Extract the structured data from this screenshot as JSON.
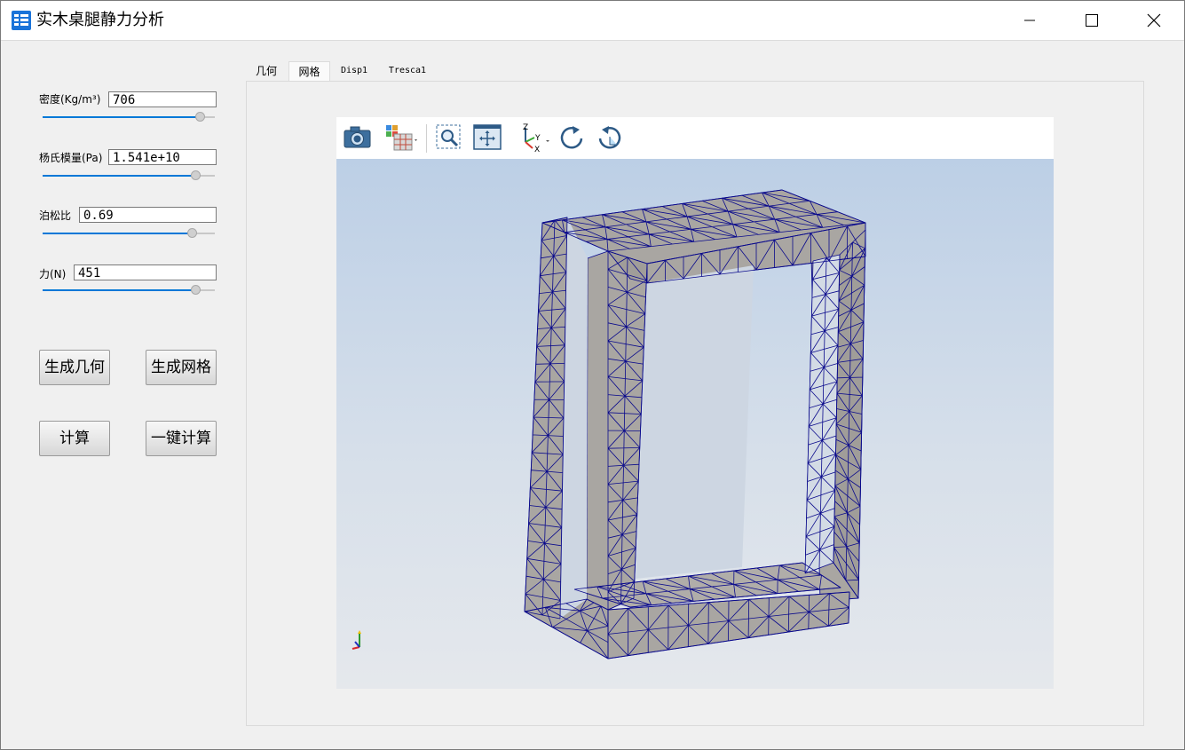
{
  "window": {
    "title": "实木桌腿静力分析"
  },
  "params": [
    {
      "label": "密度(Kg/m³)",
      "value": "706",
      "slider_fraction": 0.94
    },
    {
      "label": "杨氏模量(Pa)",
      "value": "1.541e+10",
      "slider_fraction": 0.91
    },
    {
      "label": "泊松比",
      "value": "0.69",
      "slider_fraction": 0.89
    },
    {
      "label": "力(N)",
      "value": "451",
      "slider_fraction": 0.91
    }
  ],
  "buttons": {
    "generate_geometry": "生成几何",
    "generate_mesh": "生成网格",
    "compute": "计算",
    "one_click_compute": "一键计算"
  },
  "tabs": [
    {
      "label": "几何",
      "active": false
    },
    {
      "label": "网格",
      "active": true
    },
    {
      "label": "Disp1",
      "active": false
    },
    {
      "label": "Tresca1",
      "active": false
    }
  ],
  "viewer": {
    "toolbar_icons": [
      "camera-icon",
      "display-mode-icon",
      "zoom-box-icon",
      "fit-view-icon",
      "axis-orientation-icon",
      "rotate-cw-icon",
      "rotate-ccw-icon"
    ],
    "axis_labels": {
      "z": "Z",
      "y": "Y",
      "x": "X"
    },
    "model_face_color": "#a9a6a2",
    "mesh_edge_color": "#0a0a8c"
  }
}
